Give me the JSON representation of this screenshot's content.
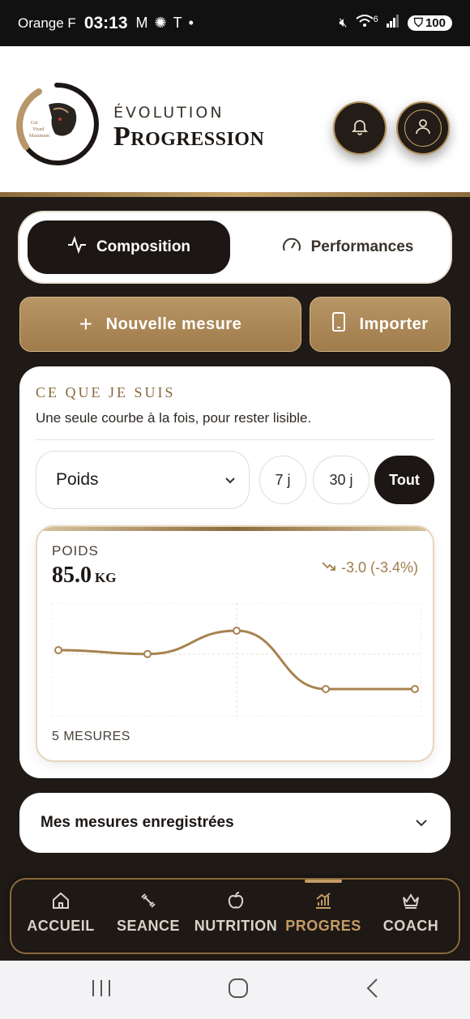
{
  "status_bar": {
    "carrier": "Orange F",
    "time": "03:13",
    "battery": "100",
    "network_label": "6"
  },
  "header": {
    "logo_text": "Get Vixed Maximum",
    "subtitle": "ÉVOLUTION",
    "title": "Progression",
    "notification_icon": "bell-icon",
    "profile_icon": "user-icon"
  },
  "tabs": [
    {
      "label": "Composition",
      "icon": "activity-icon",
      "active": true
    },
    {
      "label": "Performances",
      "icon": "gauge-icon",
      "active": false
    }
  ],
  "actions": {
    "new_label": "Nouvelle mesure",
    "import_label": "Importer"
  },
  "card": {
    "title": "Ce que je suis",
    "description": "Une seule courbe à la fois, pour rester lisible.",
    "metric_select": "Poids",
    "ranges": [
      "7 j",
      "30 j",
      "Tout"
    ],
    "active_range": "Tout",
    "metric_label": "POIDS",
    "metric_value": "85.0",
    "metric_unit": "KG",
    "delta": "-3.0 (-3.4%)",
    "measures_count": "5 MESURES"
  },
  "chart_data": {
    "type": "line",
    "x": [
      1,
      2,
      3,
      4,
      5
    ],
    "values": [
      87.0,
      86.8,
      88.0,
      85.0,
      85.0
    ],
    "ylim": [
      84,
      89
    ],
    "grid": true,
    "color": "#a8824f"
  },
  "records": {
    "label": "Mes mesures enregistrées"
  },
  "nav": [
    {
      "label": "ACCUEIL",
      "icon": "home-icon",
      "active": false
    },
    {
      "label": "SEANCE",
      "icon": "dumbbell-icon",
      "active": false
    },
    {
      "label": "NUTRITION",
      "icon": "apple-icon",
      "active": false
    },
    {
      "label": "PROGRES",
      "icon": "chart-icon",
      "active": true
    },
    {
      "label": "COACH",
      "icon": "crown-icon",
      "active": false
    }
  ],
  "colors": {
    "gold": "#b89566",
    "dark": "#1c1714",
    "accent": "#c49c66"
  }
}
